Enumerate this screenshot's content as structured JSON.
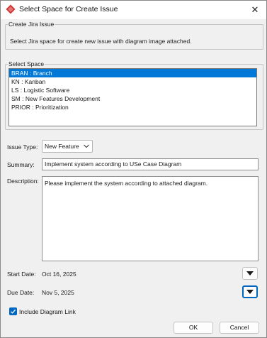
{
  "window": {
    "title": "Select Space for Create Issue",
    "icon": "visual-paradigm-logo-icon",
    "close_glyph": "✕"
  },
  "create_group": {
    "legend": "Create Jira Issue",
    "description": "Select Jira space for create new issue with diagram image attached."
  },
  "space_group": {
    "legend": "Select Space",
    "items": [
      {
        "label": "BRAN : Branch",
        "selected": true
      },
      {
        "label": "KN : Kanban",
        "selected": false
      },
      {
        "label": "LS : Logistic Software",
        "selected": false
      },
      {
        "label": "SM : New Features Development",
        "selected": false
      },
      {
        "label": "PRIOR : Prioritization",
        "selected": false
      }
    ]
  },
  "form": {
    "issue_type_label": "Issue Type:",
    "issue_type_value": "New Feature",
    "summary_label": "Summary:",
    "summary_value": "Implement system according to USe Case Diagram",
    "description_label": "Description:",
    "description_value": "Please implement the system according to attached diagram.",
    "start_date_label": "Start Date:",
    "start_date_value": "Oct 16, 2025",
    "due_date_label": "Due Date:",
    "due_date_value": "Nov 5, 2025",
    "include_link_label": "Include Diagram Link",
    "include_link_checked": true
  },
  "buttons": {
    "ok": "OK",
    "cancel": "Cancel"
  },
  "colors": {
    "accent": "#0067c0",
    "selection": "#0078d7",
    "logo": "#d32f2f"
  }
}
